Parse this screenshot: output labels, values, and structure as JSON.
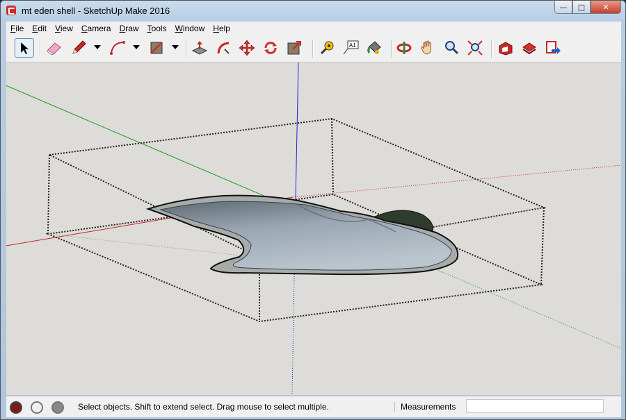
{
  "window": {
    "title": "mt eden shell - SketchUp Make 2016",
    "controls": {
      "minimize": "—",
      "maximize": "□",
      "close": "✕"
    }
  },
  "menu": [
    {
      "underline": "F",
      "rest": "ile"
    },
    {
      "underline": "E",
      "rest": "dit"
    },
    {
      "underline": "V",
      "rest": "iew"
    },
    {
      "underline": "C",
      "rest": "amera"
    },
    {
      "underline": "D",
      "rest": "raw"
    },
    {
      "underline": "T",
      "rest": "ools"
    },
    {
      "underline": "W",
      "rest": "indow"
    },
    {
      "underline": "H",
      "rest": "elp"
    }
  ],
  "toolbar": {
    "tools": [
      "select-tool",
      "eraser-tool",
      "line-tool",
      "arc-tool",
      "shape-tool",
      "push-pull-tool",
      "follow-me-tool",
      "move-tool",
      "rotate-tool",
      "scale-tool",
      "tape-measure-tool",
      "text-tool",
      "paint-bucket-tool",
      "orbit-tool",
      "pan-tool",
      "zoom-tool",
      "zoom-extents-tool",
      "3d-warehouse-tool",
      "extension-warehouse-tool",
      "layout-send-tool"
    ],
    "text_label": "A1"
  },
  "status": {
    "hint": "Select objects. Shift to extend select. Drag mouse to select multiple.",
    "measurements_label": "Measurements",
    "measurements_value": ""
  },
  "colors": {
    "axis_red": "#cc2222",
    "axis_green": "#1a9a1a",
    "axis_blue": "#2222cc",
    "background": "#dddcd8",
    "model_fill": "#9aa7b3"
  }
}
